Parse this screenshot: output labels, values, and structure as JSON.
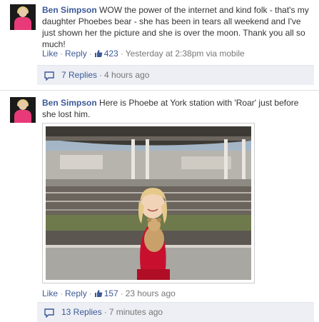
{
  "posts": [
    {
      "author": "Ben Simpson",
      "text": "WOW the power of the internet and kind folk - that's my daughter Phoebes bear - she has been in tears all weekend and I've just shown her the picture and she is over the moon. Thank you all so much!",
      "like_label": "Like",
      "reply_label": "Reply",
      "like_count": "423",
      "timestamp": "Yesterday at 2:38pm via mobile",
      "replies_label": "7 Replies",
      "replies_time": "4 hours ago"
    },
    {
      "author": "Ben Simpson",
      "text": "Here is Phoebe at York station with 'Roar' just before she lost him.",
      "like_label": "Like",
      "reply_label": "Reply",
      "like_count": "157",
      "timestamp": "23 hours ago",
      "replies_label": "13 Replies",
      "replies_time": "7 minutes ago"
    }
  ],
  "separator": "·",
  "colors": {
    "link": "#3b5998",
    "meta": "#777777",
    "replies_bg": "#edeff4"
  },
  "icons": {
    "like": "thumbs-up-icon",
    "replies": "comment-bubble-icon"
  }
}
